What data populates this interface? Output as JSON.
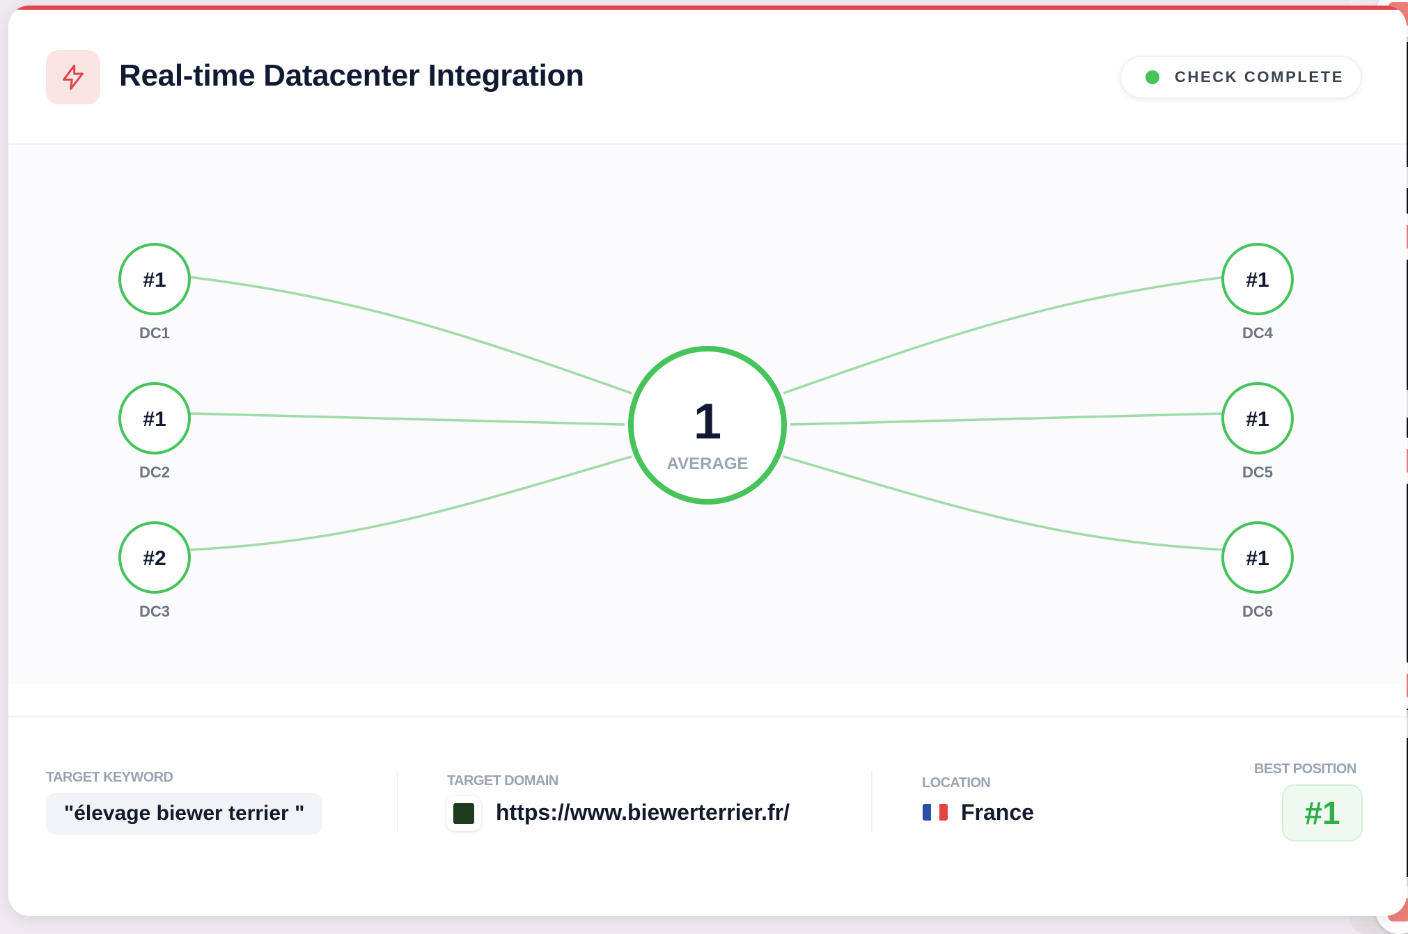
{
  "header": {
    "title": "Real-time Datacenter Integration",
    "status": "CHECK COMPLETE",
    "icon": "bolt-icon"
  },
  "diagram": {
    "average_value": "1",
    "average_label": "AVERAGE",
    "datacenters": [
      {
        "name": "DC1",
        "rank": "#1"
      },
      {
        "name": "DC2",
        "rank": "#1"
      },
      {
        "name": "DC3",
        "rank": "#2"
      },
      {
        "name": "DC4",
        "rank": "#1"
      },
      {
        "name": "DC5",
        "rank": "#1"
      },
      {
        "name": "DC6",
        "rank": "#1"
      }
    ]
  },
  "footer": {
    "keyword_label": "TARGET KEYWORD",
    "keyword": "\"élevage biewer terrier \"",
    "domain_label": "TARGET DOMAIN",
    "domain": "https://www.biewerterrier.fr/",
    "location_label": "LOCATION",
    "location": "France",
    "best_label": "BEST POSITION",
    "best_value": "#1"
  },
  "colors": {
    "accent_red": "#e0454a",
    "success_green": "#45c45c",
    "text_dark": "#121a33",
    "muted": "#9aa3b2"
  }
}
